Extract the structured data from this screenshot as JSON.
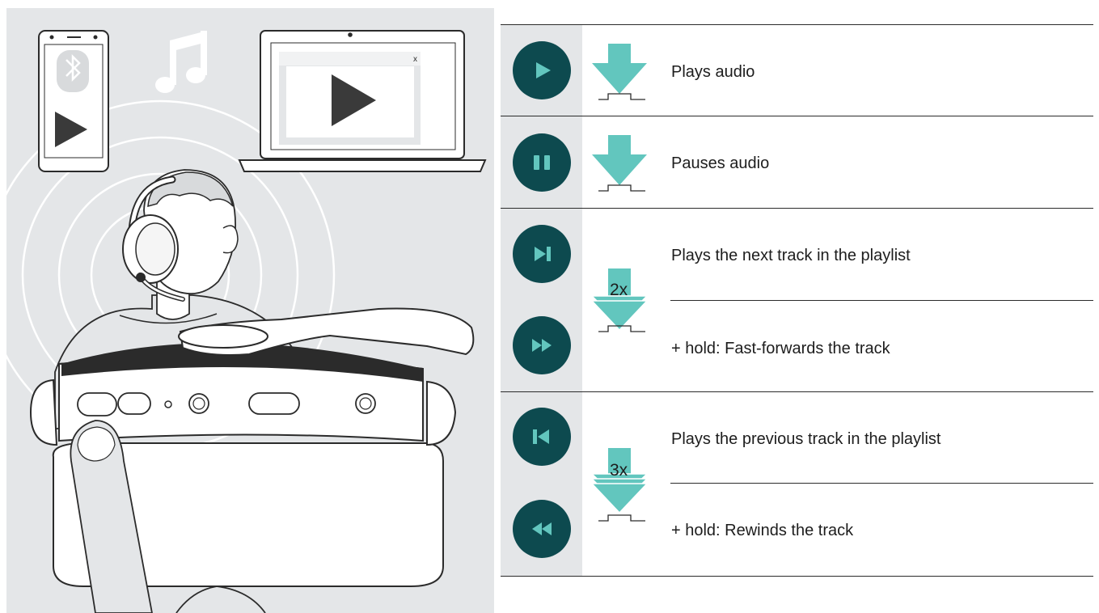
{
  "colors": {
    "background_gray": "#e4e6e8",
    "button_teal": "#0d4a4f",
    "arrow_teal": "#62c6be",
    "line": "#2b2b2b",
    "play_triangle": "#3a3a3a"
  },
  "illustration": {
    "phone_icons": [
      "bluetooth-icon",
      "play-icon"
    ],
    "music_icon": "music-note-icon",
    "laptop_window_close": "x",
    "laptop_icon": "play-icon"
  },
  "rows": [
    {
      "icon": "play-icon",
      "press": "single",
      "description": "Plays audio"
    },
    {
      "icon": "pause-icon",
      "press": "single",
      "description": "Pauses audio"
    },
    {
      "icon": "next-track-icon",
      "press": "double",
      "description": "Plays the next track in the playlist"
    },
    {
      "icon": "fast-forward-icon",
      "press": "double-hold",
      "description": "+ hold: Fast-forwards the track"
    },
    {
      "icon": "previous-track-icon",
      "press": "triple",
      "description": "Plays the previous track in the playlist"
    },
    {
      "icon": "rewind-icon",
      "press": "triple-hold",
      "description": "+ hold: Rewinds the track"
    }
  ],
  "press_counts": {
    "double": "2x",
    "triple": "3x"
  }
}
